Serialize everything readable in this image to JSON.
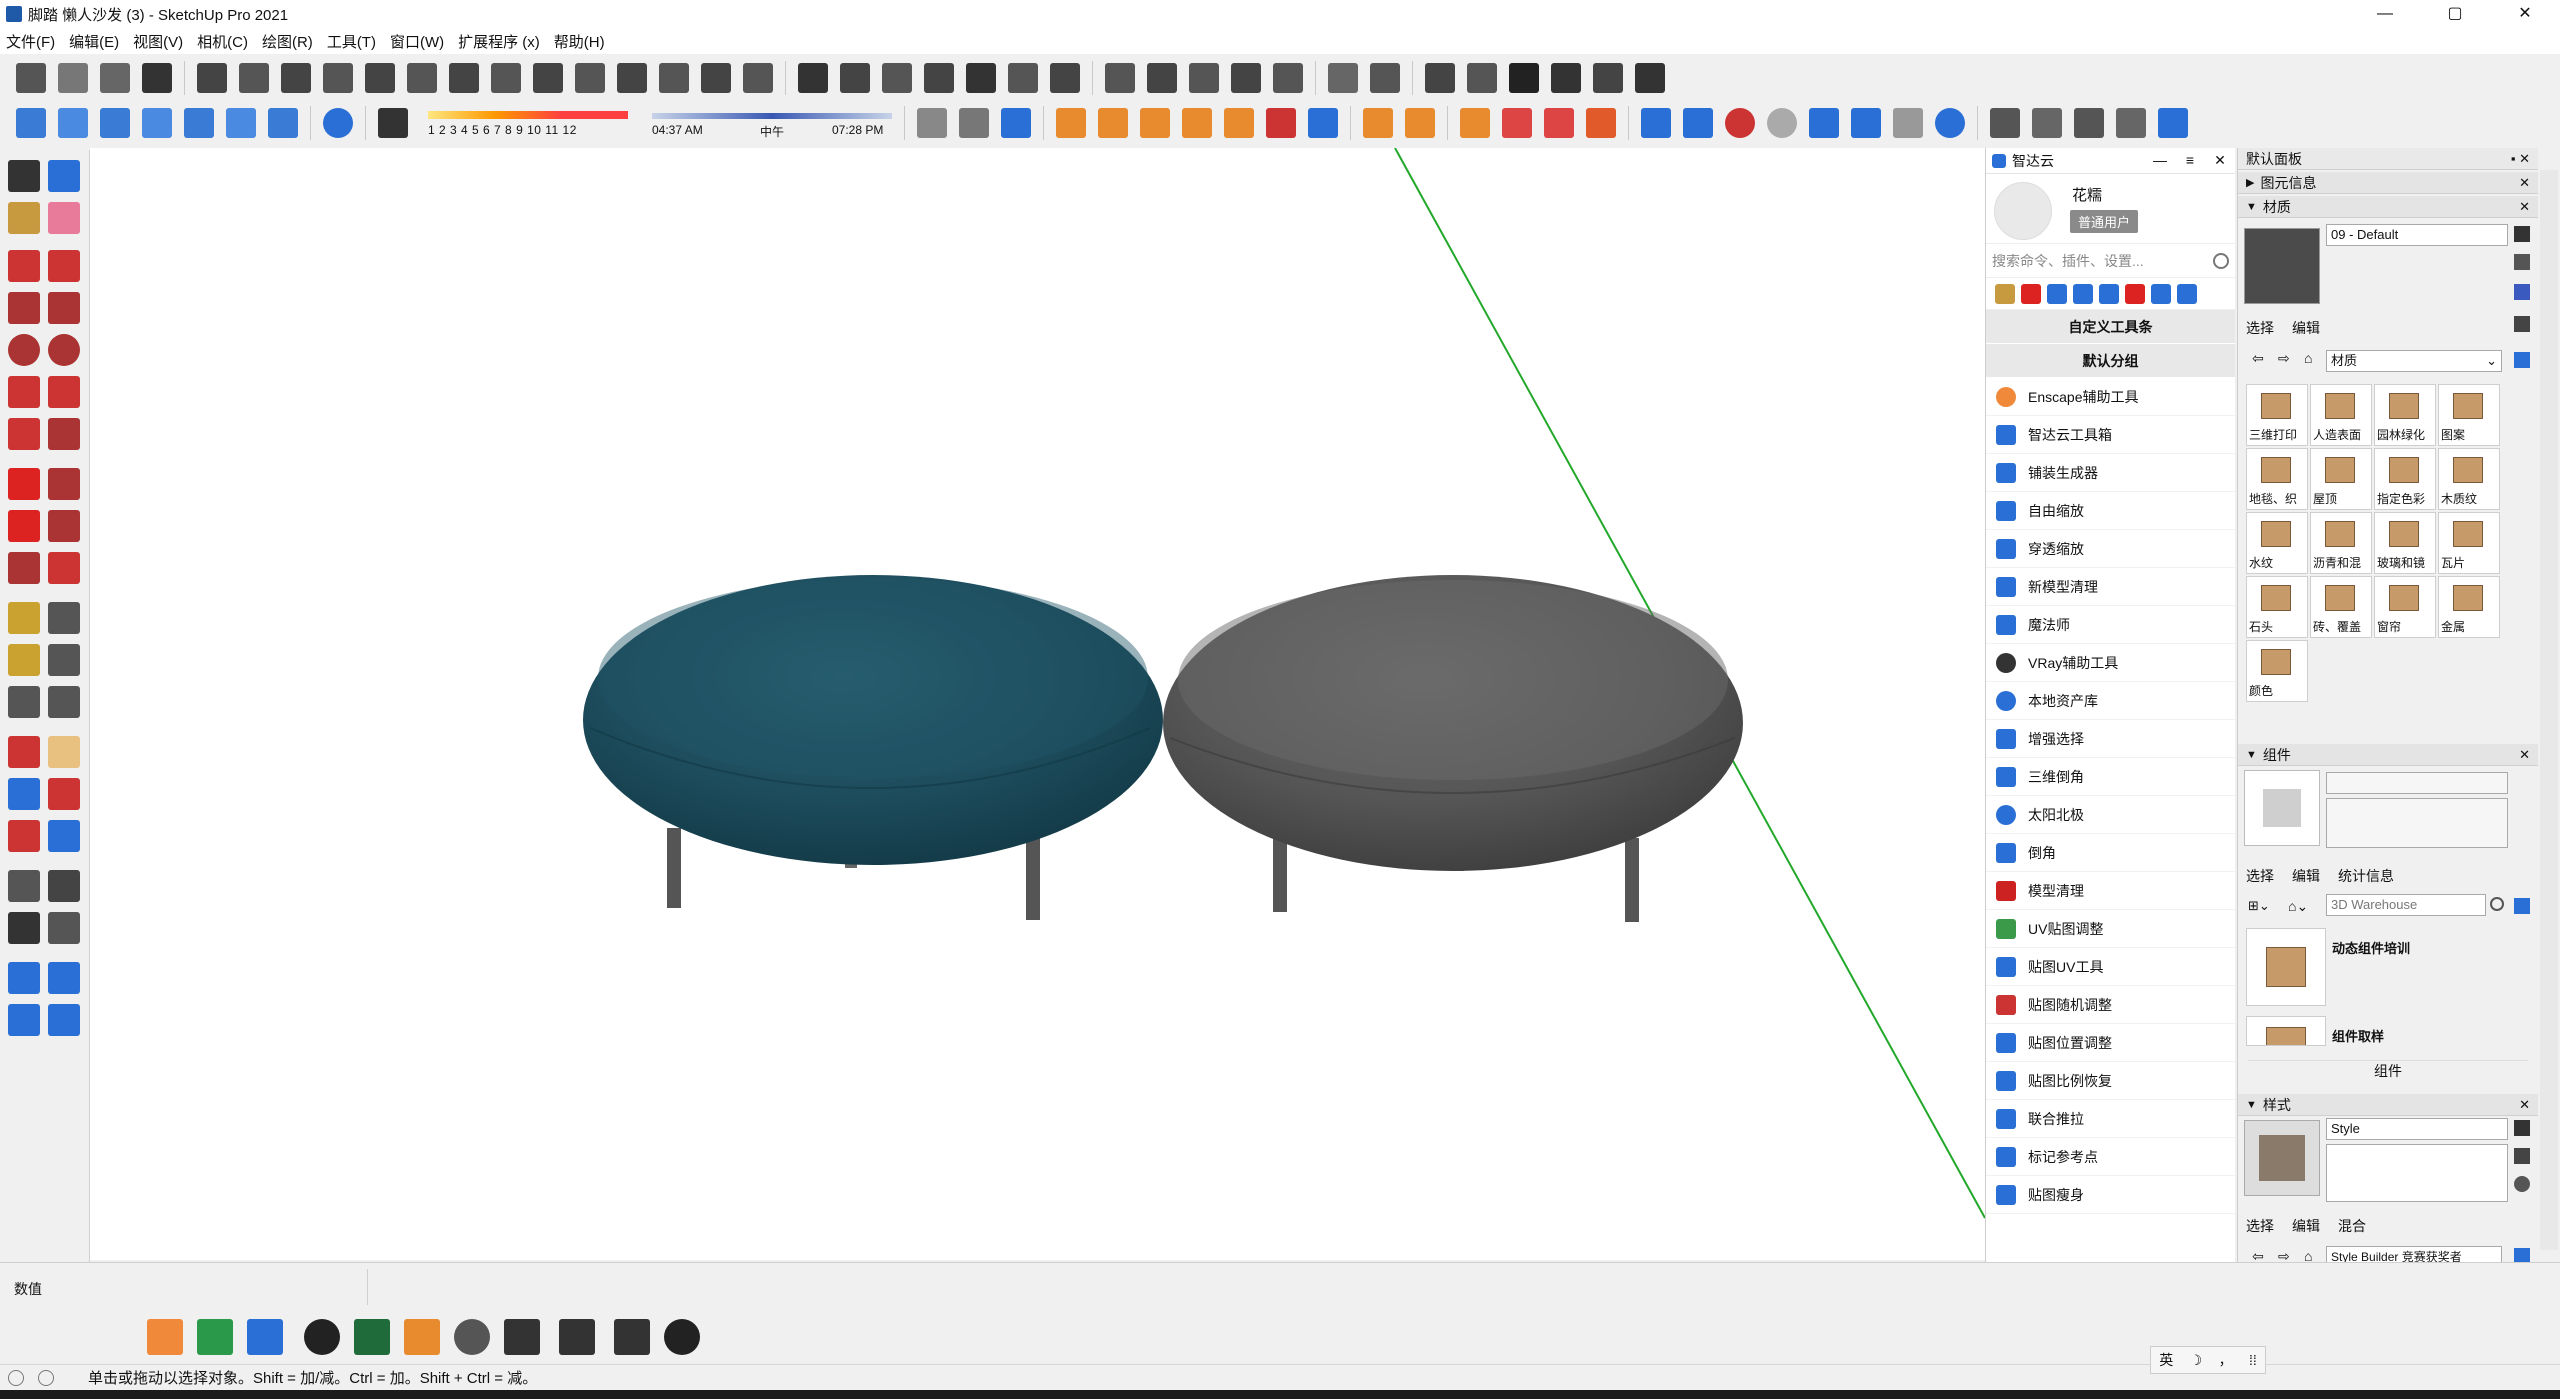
{
  "window": {
    "title": "脚踏 懒人沙发 (3) - SketchUp Pro 2021",
    "minimize": "—",
    "maximize": "▢",
    "close": "✕"
  },
  "menu": [
    "文件(F)",
    "编辑(E)",
    "视图(V)",
    "相机(C)",
    "绘图(R)",
    "工具(T)",
    "窗口(W)",
    "扩展程序 (x)",
    "帮助(H)"
  ],
  "shadow": {
    "months": "1 2 3 4 5 6 7 8 9 10 11 12",
    "time_start": "04:37 AM",
    "time_mid": "中午",
    "time_end": "07:28 PM"
  },
  "zhida": {
    "title": "智达云",
    "user_name": "花糯",
    "user_badge": "普通用户",
    "search_placeholder": "搜索命令、插件、设置...",
    "custom_toolbar": "自定义工具条",
    "default_group": "默认分组",
    "items": [
      "Enscape辅助工具",
      "智达云工具箱",
      "铺装生成器",
      "自由缩放",
      "穿透缩放",
      "新模型清理",
      "魔法师",
      "VRay辅助工具",
      "本地资产库",
      "增强选择",
      "三维倒角",
      "太阳北极",
      "倒角",
      "模型清理",
      "UV贴图调整",
      "贴图UV工具",
      "贴图随机调整",
      "贴图位置调整",
      "贴图比例恢复",
      "联合推拉",
      "标记参考点",
      "贴图瘦身"
    ]
  },
  "tray": {
    "title": "默认面板",
    "entity_info": "图元信息",
    "materials": "材质",
    "material_name": "09 - Default",
    "mat_tabs": [
      "选择",
      "编辑"
    ],
    "mat_library": "材质",
    "mat_cells": [
      "三维打印",
      "人造表面",
      "园林绿化",
      "图案",
      "地毯、织",
      "屋顶",
      "指定色彩",
      "木质纹",
      "水纹",
      "沥青和混",
      "玻璃和镜",
      "瓦片",
      "石头",
      "砖、覆盖",
      "窗帘",
      "金属",
      "颜色"
    ],
    "components": "组件",
    "comp_tabs": [
      "选择",
      "编辑",
      "统计信息"
    ],
    "comp_search": "3D Warehouse",
    "comp_items": [
      "动态组件培训",
      "组件取样"
    ],
    "comp_footer": "组件",
    "styles": "样式",
    "style_name": "Style",
    "style_tabs": [
      "选择",
      "编辑",
      "混合"
    ],
    "style_lib": "Style Builder 竞赛获奖者"
  },
  "measure_label": "数值",
  "status_text": "单击或拖动以选择对象。Shift = 加/减。Ctrl = 加。Shift + Ctrl = 减。",
  "ime": {
    "lang": "英",
    "moon": "☽",
    "punct": "，",
    "grid": "⁞⁞"
  }
}
